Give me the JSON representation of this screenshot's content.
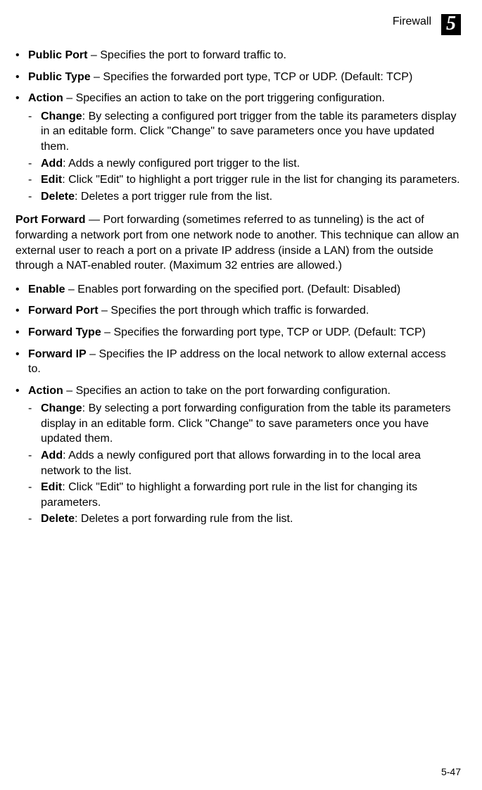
{
  "header": {
    "title": "Firewall",
    "chapter": "5"
  },
  "list1": {
    "public_port_label": "Public Port",
    "public_port_text": " – Specifies the port to forward traffic to.",
    "public_type_label": "Public Type",
    "public_type_text": " – Specifies the forwarded port type, TCP or UDP. (Default: TCP)",
    "action_label": "Action",
    "action_text": " – Specifies an action to take on the port triggering configuration.",
    "sub": {
      "change_label": "Change",
      "change_text": ": By selecting a configured port trigger from the table its parameters display in an editable form. Click \"Change\" to save parameters once you have updated them.",
      "add_label": "Add",
      "add_text": ": Adds a newly configured port trigger to the list.",
      "edit_label": "Edit",
      "edit_text": ": Click \"Edit\" to highlight a port trigger rule in the list for changing its parameters.",
      "delete_label": "Delete",
      "delete_text": ": Deletes a port trigger rule from the list."
    }
  },
  "port_forward_label": "Port Forward",
  "port_forward_text": " — Port forwarding (sometimes referred to as tunneling) is the act of forwarding a network port from one network node to another. This technique can allow an external user to reach a port on a private IP address (inside a LAN) from the outside through a NAT-enabled router. (Maximum 32 entries are allowed.)",
  "list2": {
    "enable_label": "Enable",
    "enable_text": " – Enables port forwarding on the specified port. (Default: Disabled)",
    "forward_port_label": "Forward Port",
    "forward_port_text": " – Specifies the port through which traffic is forwarded.",
    "forward_type_label": "Forward Type",
    "forward_type_text": " – Specifies the forwarding port type, TCP or UDP. (Default: TCP)",
    "forward_ip_label": "Forward IP",
    "forward_ip_text": " – Specifies the IP address on the local network to allow external access to.",
    "action_label": "Action",
    "action_text": " – Specifies an action to take on the port forwarding configuration.",
    "sub": {
      "change_label": "Change",
      "change_text": ": By selecting a port forwarding configuration from the table its parameters display in an editable form. Click \"Change\" to save parameters once you have updated them.",
      "add_label": "Add",
      "add_text": ": Adds a newly configured port that allows forwarding in to the local area network to the list.",
      "edit_label": "Edit",
      "edit_text": ": Click \"Edit\" to highlight a forwarding port rule in the list for changing its parameters.",
      "delete_label": "Delete",
      "delete_text": ": Deletes a port forwarding rule from the list."
    }
  },
  "page_number": "5-47"
}
